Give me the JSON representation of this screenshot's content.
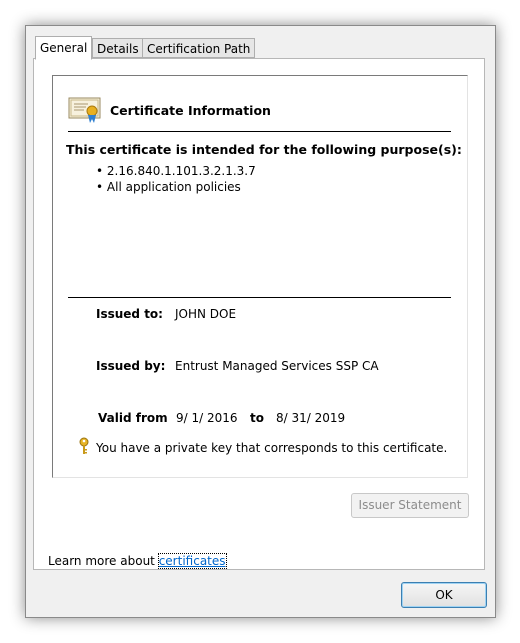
{
  "tabs": [
    {
      "label": "General",
      "active": true
    },
    {
      "label": "Details",
      "active": false
    },
    {
      "label": "Certification Path",
      "active": false
    }
  ],
  "certificate": {
    "header": "Certificate Information",
    "purpose_heading": "This certificate is intended for the following purpose(s):",
    "purposes": [
      "2.16.840.1.101.3.2.1.3.7",
      "All application policies"
    ],
    "issued_to_label": "Issued to:",
    "issued_to": "JOHN DOE",
    "issued_by_label": "Issued by:",
    "issued_by": "Entrust Managed Services SSP CA",
    "valid_from_label": "Valid from",
    "valid_from": "9/ 1/ 2016",
    "valid_to_label": "to",
    "valid_to": "8/ 31/ 2019",
    "private_key_note": "You have a private key that corresponds to this certificate."
  },
  "buttons": {
    "issuer_statement": "Issuer Statement",
    "ok": "OK"
  },
  "learn_more": {
    "prefix": "Learn more about",
    "link": "certificates"
  },
  "icons": [
    "certificate-icon",
    "key-icon"
  ]
}
